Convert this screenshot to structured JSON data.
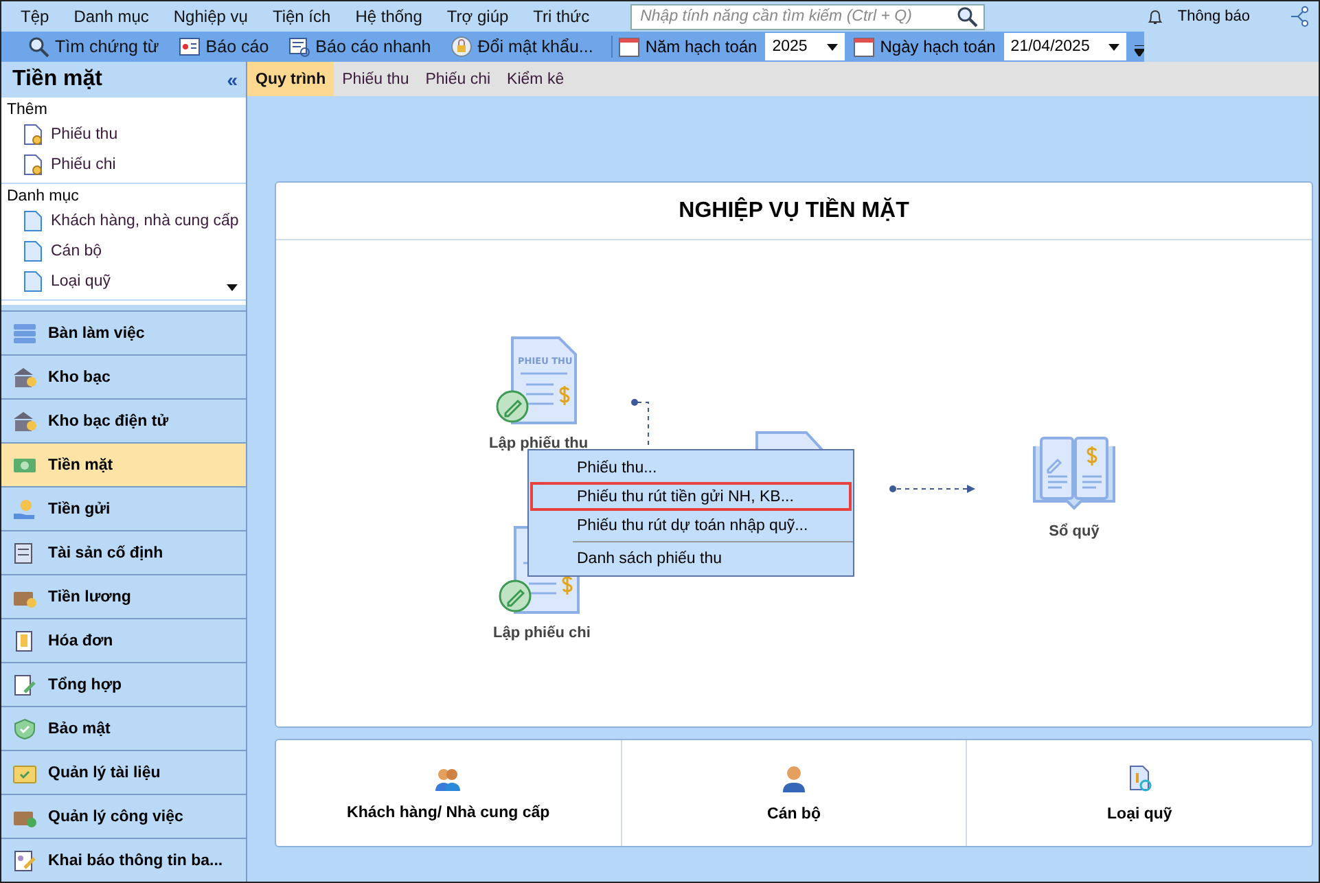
{
  "menu_bar": {
    "items": [
      "Tệp",
      "Danh mục",
      "Nghiệp vụ",
      "Tiện ích",
      "Hệ thống",
      "Trợ giúp",
      "Tri thức"
    ],
    "search": {
      "placeholder": "Nhập tính năng cần tìm kiếm (Ctrl + Q)"
    },
    "notification": "Thông báo"
  },
  "toolbar": {
    "buttons": [
      {
        "label": "Tìm chứng từ",
        "kind": "search"
      },
      {
        "label": "Báo cáo",
        "kind": "report"
      },
      {
        "label": "Báo cáo nhanh",
        "kind": "quick-report"
      },
      {
        "label": "Đổi mật khẩu...",
        "kind": "lock"
      }
    ],
    "year": {
      "label": "Năm hạch toán",
      "value": "2025"
    },
    "date": {
      "label": "Ngày hạch toán",
      "value": "21/04/2025"
    }
  },
  "sidebar": {
    "title": "Tiền mặt",
    "collapse": "«",
    "sections": [
      {
        "title": "Thêm",
        "items": [
          {
            "label": "Phiếu thu",
            "kind": "new-doc"
          },
          {
            "label": "Phiếu chi",
            "kind": "new-doc"
          }
        ]
      },
      {
        "title": "Danh mục",
        "items": [
          {
            "label": "Khách hàng, nhà cung cấp",
            "kind": "doc"
          },
          {
            "label": "Cán bộ",
            "kind": "doc"
          },
          {
            "label": "Loại quỹ",
            "kind": "doc"
          }
        ]
      }
    ],
    "nav": [
      {
        "label": "Bàn làm việc",
        "kind": "desk",
        "selected": false
      },
      {
        "label": "Kho bạc",
        "kind": "bank",
        "selected": false
      },
      {
        "label": "Kho bạc điện tử",
        "kind": "bank",
        "selected": false
      },
      {
        "label": "Tiền mặt",
        "kind": "cash",
        "selected": true
      },
      {
        "label": "Tiền gửi",
        "kind": "deposit",
        "selected": false
      },
      {
        "label": "Tài sản cố định",
        "kind": "asset",
        "selected": false
      },
      {
        "label": "Tiền lương",
        "kind": "briefcase",
        "selected": false
      },
      {
        "label": "Hóa đơn",
        "kind": "invoice",
        "selected": false
      },
      {
        "label": "Tổng hợp",
        "kind": "summary",
        "selected": false
      },
      {
        "label": "Bảo mật",
        "kind": "shield",
        "selected": false
      },
      {
        "label": "Quản lý tài liệu",
        "kind": "folder",
        "selected": false
      },
      {
        "label": "Quản lý công việc",
        "kind": "briefcase-check",
        "selected": false
      },
      {
        "label": "Khai báo thông tin ba...",
        "kind": "form",
        "selected": false
      }
    ]
  },
  "tabs": [
    {
      "label": "Quy trình",
      "selected": true
    },
    {
      "label": "Phiếu thu",
      "selected": false
    },
    {
      "label": "Phiếu chi",
      "selected": false
    },
    {
      "label": "Kiểm kê",
      "selected": false
    }
  ],
  "process": {
    "title": "NGHIỆP VỤ TIỀN MẶT",
    "nodes": [
      {
        "label": "Lập phiếu thu",
        "kind": "receipt",
        "icon_label": "PHIEU THU"
      },
      {
        "label": "Lập phiếu chi",
        "kind": "payment"
      },
      {
        "label": "Sổ quỹ",
        "kind": "ledger"
      }
    ],
    "context_menu": {
      "items": [
        {
          "label": "Phiếu thu...",
          "highlighted": false
        },
        {
          "label": "Phiếu thu rút tiền gửi NH, KB...",
          "highlighted": true
        },
        {
          "label": "Phiếu thu rút dự toán nhập quỹ...",
          "highlighted": false
        },
        {
          "label": "Danh sách phiếu thu",
          "highlighted": false
        }
      ]
    }
  },
  "shortcuts": [
    {
      "label": "Khách hàng/ Nhà cung cấp",
      "kind": "people"
    },
    {
      "label": "Cán bộ",
      "kind": "person"
    },
    {
      "label": "Loại quỹ",
      "kind": "fund"
    }
  ]
}
